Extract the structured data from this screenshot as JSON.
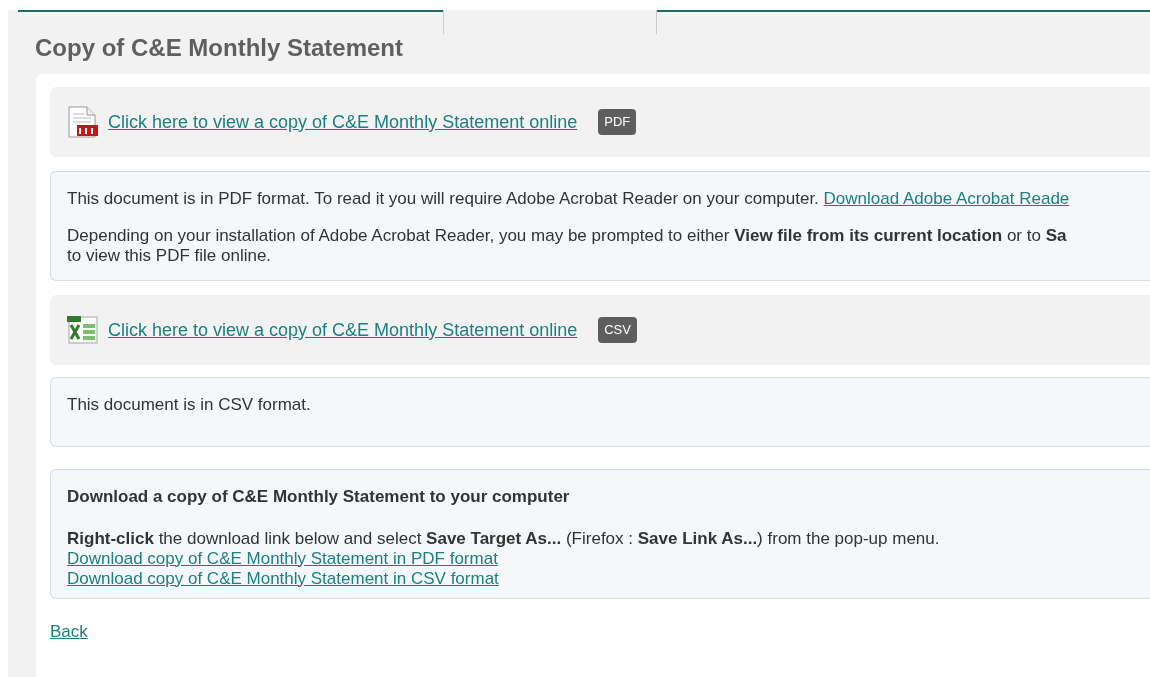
{
  "title": "Copy of C&E Monthly Statement",
  "documents": [
    {
      "kind": "pdf",
      "link": "Click here to view a copy of C&E Monthly Statement online",
      "badge": "PDF",
      "info": [
        {
          "text": "This document is in PDF format. To read it you will require Adobe Acrobat Reader on your computer. ",
          "link": "Download Adobe Acrobat Reade"
        },
        {
          "lines": [
            "Depending on your installation of Adobe Acrobat Reader, you may be prompted to either **View file from its current location** or to **Sa**",
            "to view this PDF file online."
          ]
        }
      ]
    },
    {
      "kind": "csv",
      "link": "Click here to view a copy of C&E Monthly Statement online",
      "badge": "CSV",
      "info": [
        {
          "text": "This document is in CSV format."
        }
      ]
    }
  ],
  "download": {
    "heading": "Download a copy of C&E Monthly Statement to your computer",
    "instruction": "**Right-click** the download link below and select **Save Target As...** (Firefox : **Save Link As...**) from the pop-up menu.",
    "links": [
      "Download copy of C&E Monthly Statement in PDF format",
      "Download copy of C&E Monthly Statement in CSV format"
    ]
  },
  "back": "Back"
}
